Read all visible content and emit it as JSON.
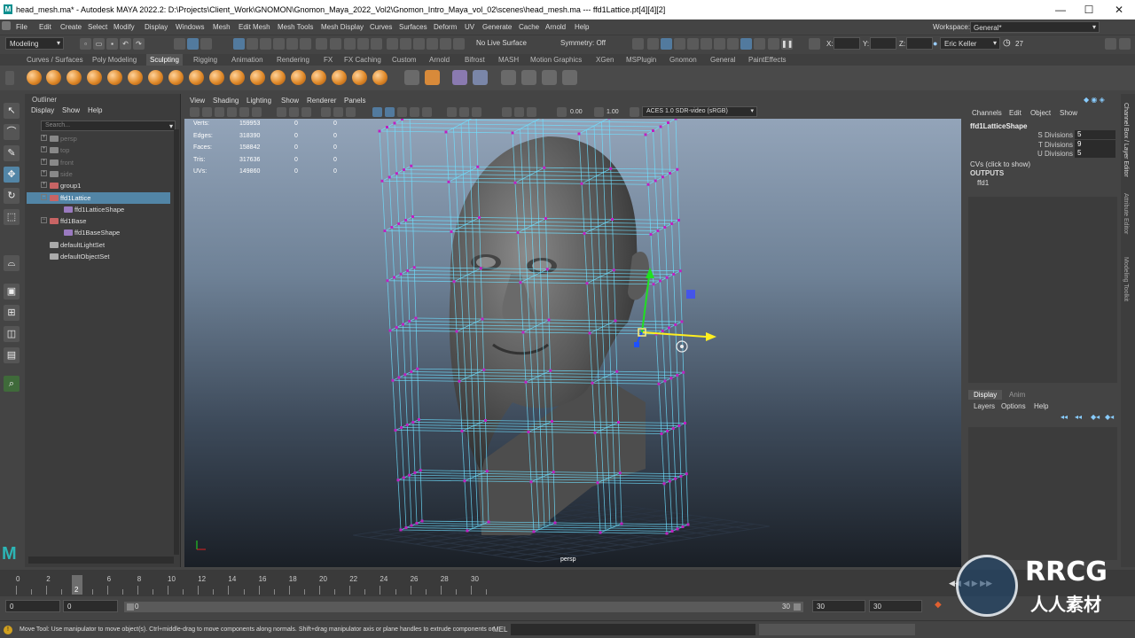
{
  "title_bar": {
    "text": "head_mesh.ma* - Autodesk MAYA 2022.2: D:\\Projects\\Client_Work\\GNOMON\\Gnomon_Maya_2022_Vol2\\Gnomon_Intro_Maya_vol_02\\scenes\\head_mesh.ma   ---   ffd1Lattice.pt[4][4][2]",
    "app_letter": "M",
    "controls": [
      "—",
      "☐",
      "✕"
    ]
  },
  "menus": [
    "File",
    "Edit",
    "Create",
    "Select",
    "Modify",
    "Display",
    "Windows",
    "Mesh",
    "Edit Mesh",
    "Mesh Tools",
    "Mesh Display",
    "Curves",
    "Surfaces",
    "Deform",
    "UV",
    "Generate",
    "Cache",
    "Arnold",
    "Help"
  ],
  "workspace": {
    "label": "Workspace:",
    "value": "General*"
  },
  "status_line": {
    "menu_set": "Modeling",
    "live_surface": "No Live Surface",
    "symmetry": "Symmetry: Off",
    "x_label": "X:",
    "y_label": "Y:",
    "z_label": "Z:",
    "user": "Eric Keller",
    "counter": "27"
  },
  "shelf_tabs": [
    "Curves / Surfaces",
    "Poly Modeling",
    "Sculpting",
    "Rigging",
    "Animation",
    "Rendering",
    "FX",
    "FX Caching",
    "Custom",
    "Arnold",
    "Bifrost",
    "MASH",
    "Motion Graphics",
    "XGen",
    "MSPlugin",
    "Gnomon",
    "General",
    "PaintEffects"
  ],
  "shelf_active": "Sculpting",
  "outliner": {
    "title": "Outliner",
    "menus": [
      "Display",
      "Show",
      "Help"
    ],
    "search_placeholder": "Search...",
    "items": [
      {
        "label": "persp",
        "dim": true,
        "expand": "+",
        "selected": false
      },
      {
        "label": "top",
        "dim": true,
        "expand": "+",
        "selected": false
      },
      {
        "label": "front",
        "dim": true,
        "expand": "+",
        "selected": false
      },
      {
        "label": "side",
        "dim": true,
        "expand": "+",
        "selected": false
      },
      {
        "label": "group1",
        "dim": false,
        "expand": "+",
        "selected": false
      },
      {
        "label": "ffd1Lattice",
        "dim": false,
        "expand": "−",
        "selected": true
      },
      {
        "label": "ffd1LatticeShape",
        "dim": false,
        "expand": "",
        "selected": false
      },
      {
        "label": "ffd1Base",
        "dim": false,
        "expand": "−",
        "selected": false
      },
      {
        "label": "ffd1BaseShape",
        "dim": false,
        "expand": "",
        "selected": false
      },
      {
        "label": "defaultLightSet",
        "dim": false,
        "expand": "",
        "selected": false
      },
      {
        "label": "defaultObjectSet",
        "dim": false,
        "expand": "",
        "selected": false
      }
    ]
  },
  "viewport": {
    "menus": [
      "View",
      "Shading",
      "Lighting",
      "Show",
      "Renderer",
      "Panels"
    ],
    "exposure": "0.00",
    "gamma": "1.00",
    "color_space": "ACES 1.0 SDR-video (sRGB)",
    "camera": "persp",
    "hud": [
      {
        "label": "Verts:",
        "v1": "159953",
        "v2": "0",
        "v3": "0"
      },
      {
        "label": "Edges:",
        "v1": "318390",
        "v2": "0",
        "v3": "0"
      },
      {
        "label": "Faces:",
        "v1": "158842",
        "v2": "0",
        "v3": "0"
      },
      {
        "label": "Tris:",
        "v1": "317636",
        "v2": "0",
        "v3": "0"
      },
      {
        "label": "UVs:",
        "v1": "149860",
        "v2": "0",
        "v3": "0"
      }
    ]
  },
  "channel_box": {
    "menus": [
      "Channels",
      "Edit",
      "Object",
      "Show"
    ],
    "node": "ffd1LatticeShape",
    "attributes": [
      {
        "name": "S Divisions",
        "value": "5"
      },
      {
        "name": "T Divisions",
        "value": "9"
      },
      {
        "name": "U Divisions",
        "value": "5"
      }
    ],
    "cvs": "CVs (click to show)",
    "outputs": "OUTPUTS",
    "output_node": "ffd1"
  },
  "layer_editor": {
    "tabs": [
      "Display",
      "Anim"
    ],
    "menus": [
      "Layers",
      "Options",
      "Help"
    ]
  },
  "right_tabs": [
    "Channel Box / Layer Editor",
    "Attribute Editor",
    "Modeling Toolkit"
  ],
  "time_slider": {
    "ticks": [
      "0",
      "2",
      "4",
      "6",
      "8",
      "10",
      "12",
      "14",
      "16",
      "18",
      "20",
      "22",
      "24",
      "26",
      "28",
      "30"
    ],
    "current_frame": "2"
  },
  "range_slider": {
    "start": "0",
    "inner_start": "0",
    "range_start": "0",
    "range_end": "30",
    "end1": "30",
    "end2": "30"
  },
  "help_line": {
    "text": "Move Tool: Use manipulator to move object(s). Ctrl+middle-drag to move components along normals. Shift+drag manipulator axis or plane handles to extrude components or",
    "mel": "MEL"
  },
  "watermark": {
    "line1": "RRCG",
    "line2": "人人素材"
  },
  "colors": {
    "selection": "#5285a6",
    "lattice": "#6fe0ff",
    "lattice_point": "#c020c0",
    "maya_teal": "#0b8f8f"
  }
}
